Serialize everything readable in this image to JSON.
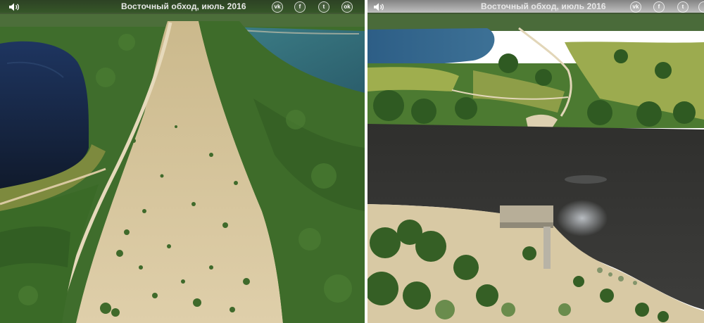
{
  "panels": [
    {
      "title": "Восточный обход, июль 2016",
      "sound_icon": "speaker-icon",
      "share": [
        {
          "network": "VKontakte",
          "icon": "vk-icon",
          "glyph": "vk"
        },
        {
          "network": "Facebook",
          "icon": "facebook-icon",
          "glyph": "f"
        },
        {
          "network": "Twitter",
          "icon": "twitter-icon",
          "glyph": "t"
        },
        {
          "network": "Odnoklassniki",
          "icon": "odnoklassniki-icon",
          "glyph": "ok"
        }
      ]
    },
    {
      "title": "Восточный обход, июль 2016",
      "sound_icon": "speaker-icon",
      "share": [
        {
          "network": "VKontakte",
          "icon": "vk-icon",
          "glyph": "vk"
        },
        {
          "network": "Facebook",
          "icon": "facebook-icon",
          "glyph": "f"
        },
        {
          "network": "Twitter",
          "icon": "twitter-icon",
          "glyph": "t"
        },
        {
          "network": "Odnoklassniki",
          "icon": "odnoklassniki-icon",
          "glyph": "ok"
        }
      ]
    }
  ],
  "colors": {
    "forest": "#3d6a2a",
    "forest_dark": "#24451b",
    "sand": "#d6c6a0",
    "lake_dark": "#1b2a44",
    "lake_teal": "#3f7f8a",
    "river": "#3a3b3a",
    "meadow": "#9aa64a",
    "toolbar_text": "#e8e8e8"
  }
}
